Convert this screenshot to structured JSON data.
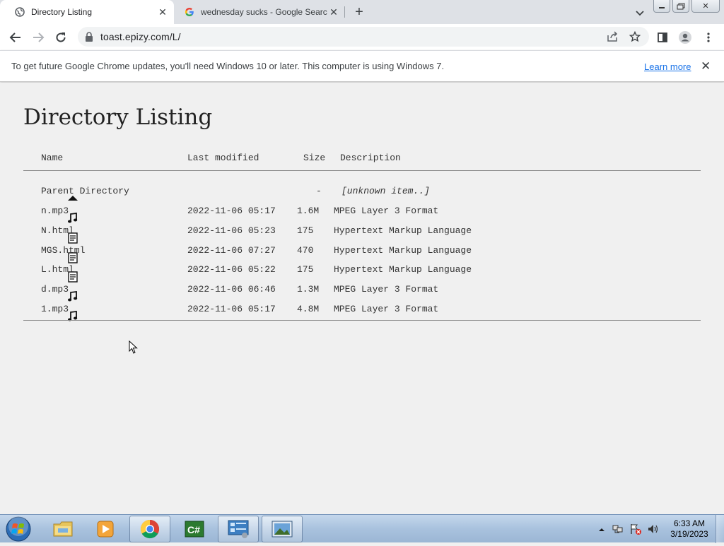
{
  "browser": {
    "tabs": [
      {
        "title": "Directory Listing",
        "active": true,
        "favicon": "globe-icon"
      },
      {
        "title": "wednesday sucks - Google Searc",
        "active": false,
        "favicon": "google-g-icon"
      }
    ],
    "new_tab_symbol": "+",
    "url": "toast.epizy.com/L/",
    "infobar": {
      "message": "To get future Google Chrome updates, you'll need Windows 10 or later. This computer is using Windows 7.",
      "link": "Learn more"
    }
  },
  "page": {
    "title": "Directory Listing",
    "columns": {
      "name": "Name",
      "last_modified": "Last modified",
      "size": "Size",
      "description": "Description"
    },
    "rows": [
      {
        "icon": "up-arrow-icon",
        "name": "Parent Directory",
        "date": "",
        "size": "-",
        "description": "[unknown item..]"
      },
      {
        "icon": "music-note-icon",
        "name": "n.mp3",
        "date": "2022-11-06 05:17",
        "size": "1.6M",
        "description": "MPEG Layer 3 Format"
      },
      {
        "icon": "document-icon",
        "name": "N.html",
        "date": "2022-11-06 05:23",
        "size": "175",
        "description": "Hypertext Markup Language"
      },
      {
        "icon": "document-icon",
        "name": "MGS.html",
        "date": "2022-11-06 07:27",
        "size": "470",
        "description": "Hypertext Markup Language"
      },
      {
        "icon": "document-icon",
        "name": "L.html",
        "date": "2022-11-06 05:22",
        "size": "175",
        "description": "Hypertext Markup Language"
      },
      {
        "icon": "music-note-icon",
        "name": "d.mp3",
        "date": "2022-11-06 06:46",
        "size": "1.3M",
        "description": "MPEG Layer 3 Format"
      },
      {
        "icon": "music-note-icon",
        "name": "1.mp3",
        "date": "2022-11-06 05:17",
        "size": "4.8M",
        "description": "MPEG Layer 3 Format"
      }
    ]
  },
  "taskbar": {
    "apps": [
      "file-explorer-icon",
      "media-player-icon",
      "chrome-icon",
      "csharp-ide-icon",
      "control-panel-icon",
      "image-viewer-icon"
    ],
    "clock": {
      "time": "6:33 AM",
      "date": "3/19/2023"
    }
  },
  "colors": {
    "link": "#1a73e8",
    "tabstrip": "#dee1e6",
    "page_bg": "#f0f0f0"
  }
}
